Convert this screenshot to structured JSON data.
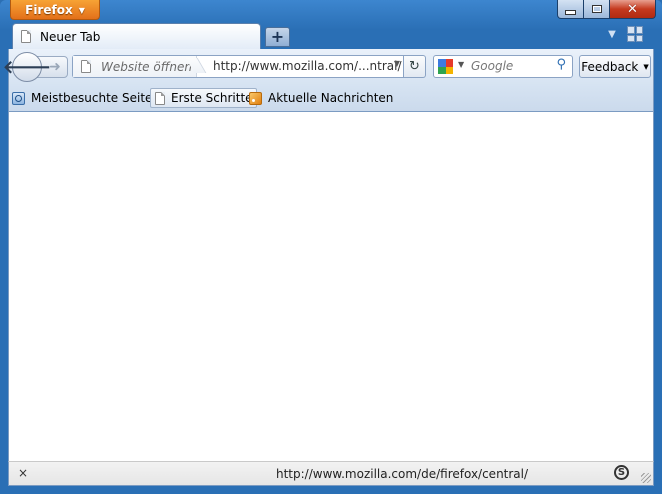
{
  "app_button": {
    "label": "Firefox"
  },
  "tabs": [
    {
      "label": "Neuer Tab"
    }
  ],
  "navbar": {
    "identity_label": "Website öffnen",
    "url": "http://www.mozilla.com/...ntral/",
    "search_placeholder": "Google",
    "feedback_label": "Feedback"
  },
  "bookmarks": [
    {
      "label": "Meistbesuchte Seiten",
      "icon": "most-visited-icon"
    },
    {
      "label": "Erste Schritte",
      "icon": "page-icon"
    },
    {
      "label": "Aktuelle Nachrichten",
      "icon": "rss-feed-icon"
    }
  ],
  "statusbar": {
    "close": "×",
    "url": "http://www.mozilla.com/de/firefox/central/"
  },
  "colors": {
    "app_button": "#e3701a",
    "window_frame": "#2a6fb5",
    "toolbar": "#d6e3f2"
  }
}
